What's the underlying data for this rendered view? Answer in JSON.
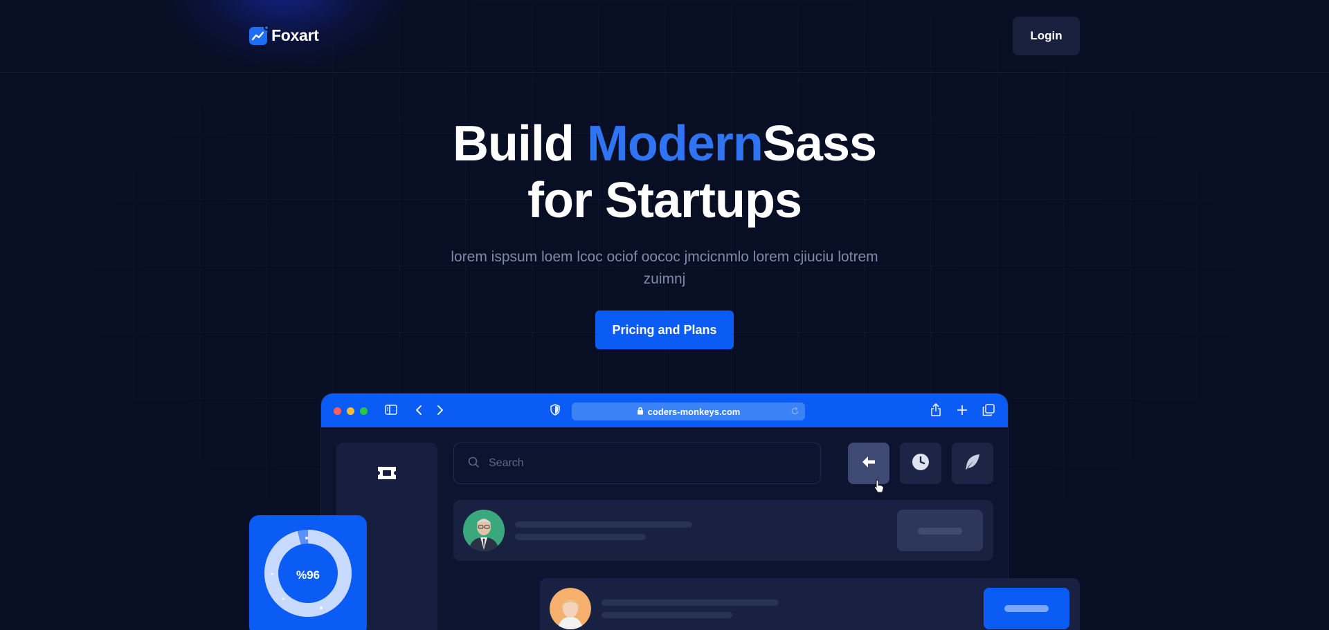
{
  "brand": {
    "name": "Foxart",
    "accent": "#0a5cf5"
  },
  "nav": {
    "login_label": "Login"
  },
  "hero": {
    "title_part1": "Build ",
    "title_accent": "Modern",
    "title_part2": "Sass",
    "title_line2": "for Startups",
    "subtitle": "lorem ispsum loem lcoc ociof oococ jmcicnmlo lorem cjiuciu lotrem zuimnj",
    "cta_label": "Pricing and Plans"
  },
  "browser": {
    "url": "coders-monkeys.com",
    "search_placeholder": "Search",
    "toolbar_icons": [
      "sidebar-toggle-icon",
      "back-icon",
      "forward-icon",
      "shield-icon",
      "lock-icon",
      "reload-icon",
      "share-icon",
      "new-tab-icon",
      "tabs-icon"
    ],
    "action_icons": [
      "arrow-left-icon",
      "clock-icon",
      "feather-icon"
    ],
    "sidebar_icon": "ticket-icon"
  },
  "progress_widget": {
    "label": "%96",
    "value": 0.96
  },
  "colors": {
    "background": "#080e23",
    "primary": "#0a5cf5",
    "title_accent": "#2f74f2",
    "card": "#182142"
  }
}
